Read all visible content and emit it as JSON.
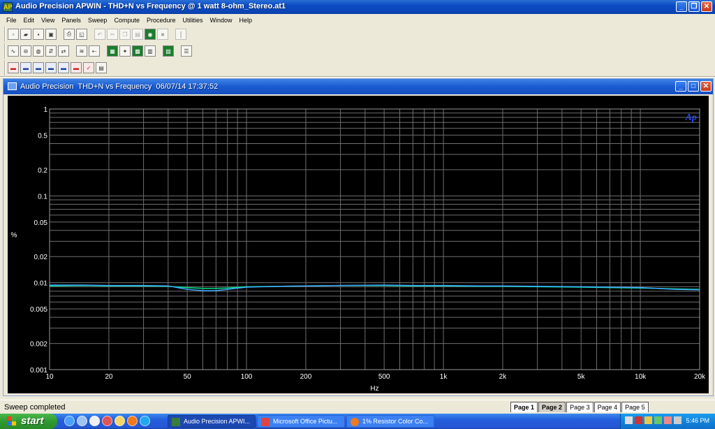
{
  "window": {
    "title": "Audio Precision APWIN - THD+N vs Frequency @ 1 watt 8-ohm_Stereo.at1",
    "app_icon_text": "AP",
    "min_glyph": "_",
    "max_glyph": "❐",
    "close_glyph": "✕"
  },
  "menu": [
    "File",
    "Edit",
    "View",
    "Panels",
    "Sweep",
    "Compute",
    "Procedure",
    "Utilities",
    "Window",
    "Help"
  ],
  "child_window": {
    "title": "Audio Precision  THD+N vs Frequency  06/07/14 17:37:52",
    "min_glyph": "_",
    "max_glyph": "□",
    "close_glyph": "✕"
  },
  "chart_data": {
    "type": "line",
    "title": "",
    "xlabel": "Hz",
    "ylabel": "%",
    "x_scale": "log",
    "y_scale": "log",
    "xlim": [
      10,
      20000
    ],
    "ylim": [
      0.001,
      1
    ],
    "x_ticks": [
      10,
      20,
      50,
      100,
      200,
      500,
      1000,
      2000,
      5000,
      10000,
      20000
    ],
    "x_tick_labels": [
      "10",
      "20",
      "50",
      "100",
      "200",
      "500",
      "1k",
      "2k",
      "5k",
      "10k",
      "20k"
    ],
    "y_ticks": [
      1,
      0.5,
      0.2,
      0.1,
      0.05,
      0.02,
      0.01,
      0.005,
      0.002,
      0.001
    ],
    "y_tick_labels": [
      "1",
      "0.5",
      "0.2",
      "0.1",
      "0.05",
      "0.02",
      "0.01",
      "0.005",
      "0.002",
      "0.001"
    ],
    "grid": true,
    "logo": "Ap",
    "series": [
      {
        "color": "#00e08a",
        "x": [
          10,
          15,
          20,
          30,
          40,
          50,
          60,
          70,
          80,
          100,
          150,
          200,
          300,
          500,
          700,
          1000,
          1500,
          2000,
          3000,
          5000,
          7000,
          10000,
          15000,
          20000
        ],
        "values": [
          0.0092,
          0.0093,
          0.0092,
          0.0092,
          0.0091,
          0.0088,
          0.0086,
          0.0086,
          0.0087,
          0.009,
          0.0091,
          0.0092,
          0.0093,
          0.0093,
          0.0092,
          0.0092,
          0.0091,
          0.0091,
          0.009,
          0.0089,
          0.0088,
          0.0087,
          0.0085,
          0.0084
        ]
      },
      {
        "color": "#3fa8ff",
        "x": [
          10,
          15,
          20,
          30,
          40,
          50,
          60,
          70,
          80,
          100,
          150,
          200,
          300,
          500,
          700,
          1000,
          1500,
          2000,
          3000,
          5000,
          7000,
          10000,
          15000,
          20000
        ],
        "values": [
          0.0094,
          0.0094,
          0.0093,
          0.0093,
          0.0092,
          0.0084,
          0.0081,
          0.0081,
          0.0084,
          0.0089,
          0.0091,
          0.0092,
          0.0093,
          0.0094,
          0.0093,
          0.0093,
          0.0092,
          0.0092,
          0.0091,
          0.009,
          0.0089,
          0.0088,
          0.0084,
          0.0083
        ]
      }
    ]
  },
  "status": {
    "text": "Sweep completed",
    "pages": [
      "Page 1",
      "Page 2",
      "Page 3",
      "Page 4",
      "Page 5"
    ]
  },
  "taskbar": {
    "start_label": "start",
    "tasks": [
      "Audio Precision APWI...",
      "Microsoft Office Pictu...",
      "1% Resistor Color Co..."
    ],
    "clock": "5:46 PM"
  }
}
